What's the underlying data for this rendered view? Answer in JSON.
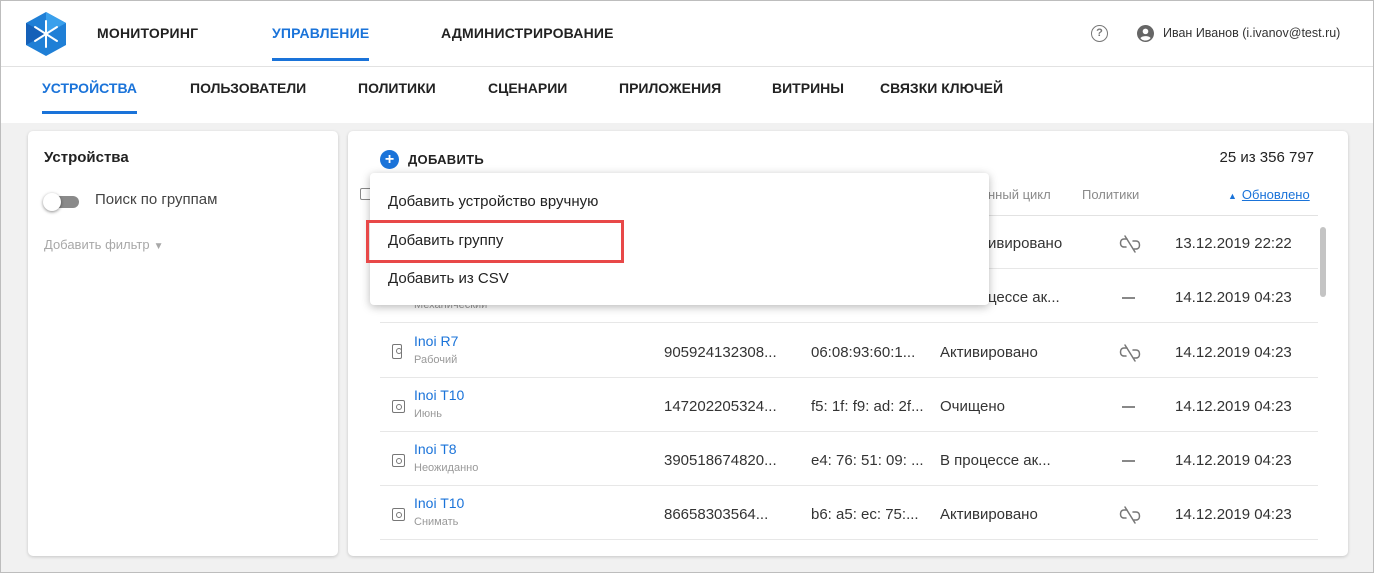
{
  "topnav": {
    "items": [
      "МОНИТОРИНГ",
      "УПРАВЛЕНИЕ",
      "АДМИНИСТРИРОВАНИЕ"
    ],
    "active": "УПРАВЛЕНИЕ",
    "help_icon": "help-circle-icon",
    "user_icon": "account-circle-icon",
    "user_name": "Иван Иванов (i.ivanov@test.ru)"
  },
  "subnav": {
    "items": [
      "УСТРОЙСТВА",
      "ПОЛЬЗОВАТЕЛИ",
      "ПОЛИТИКИ",
      "СЦЕНАРИИ",
      "ПРИЛОЖЕНИЯ",
      "ВИТРИНЫ",
      "СВЯЗКИ КЛЮЧЕЙ"
    ],
    "active": "УСТРОЙСТВА"
  },
  "left_panel": {
    "title": "Устройства",
    "group_search_label": "Поиск по группам",
    "group_search_enabled": false,
    "add_filter_label": "Добавить фильтр"
  },
  "main": {
    "add_label": "ДОБАВИТЬ",
    "count": "25 из 356 797",
    "columns": {
      "lifecycle": "нный цикл",
      "policies": "Политики",
      "updated": "Обновлено"
    },
    "sort_column": "updated",
    "rows": [
      {
        "name": "",
        "sub": "",
        "serial": "",
        "mac": "",
        "status": "ивировано",
        "policy": "unlinked",
        "updated": "13.12.2019 22:22"
      },
      {
        "name": "",
        "sub": "Механический",
        "serial": "",
        "mac": "",
        "status": "цессе ак...",
        "policy": "none",
        "updated": "14.12.2019 04:23"
      },
      {
        "name": "Inoi R7",
        "sub": "Рабочий",
        "serial": "905924132308...",
        "mac": "06:08:93:60:1...",
        "status": "Активировано",
        "policy": "unlinked",
        "updated": "14.12.2019 04:23"
      },
      {
        "name": "Inoi T10",
        "sub": "Июнь",
        "serial": "147202205324...",
        "mac": "f5: 1f: f9: ad: 2f...",
        "status": "Очищено",
        "policy": "none",
        "updated": "14.12.2019 04:23"
      },
      {
        "name": "Inoi T8",
        "sub": "Неожиданно",
        "serial": "390518674820...",
        "mac": "e4: 76: 51: 09: ...",
        "status": "В процессе ак...",
        "policy": "none",
        "updated": "14.12.2019 04:23"
      },
      {
        "name": "Inoi T10",
        "sub": "Снимать",
        "serial": "86658303564...",
        "mac": "b6: a5: ec: 75:...",
        "status": "Активировано",
        "policy": "unlinked",
        "updated": "14.12.2019 04:23"
      }
    ]
  },
  "dropdown": {
    "items": [
      "Добавить устройство вручную",
      "Добавить группу",
      "Добавить из CSV"
    ],
    "highlighted": "Добавить группу"
  },
  "colors": {
    "accent": "#1a73d9",
    "highlight": "#e84848"
  }
}
